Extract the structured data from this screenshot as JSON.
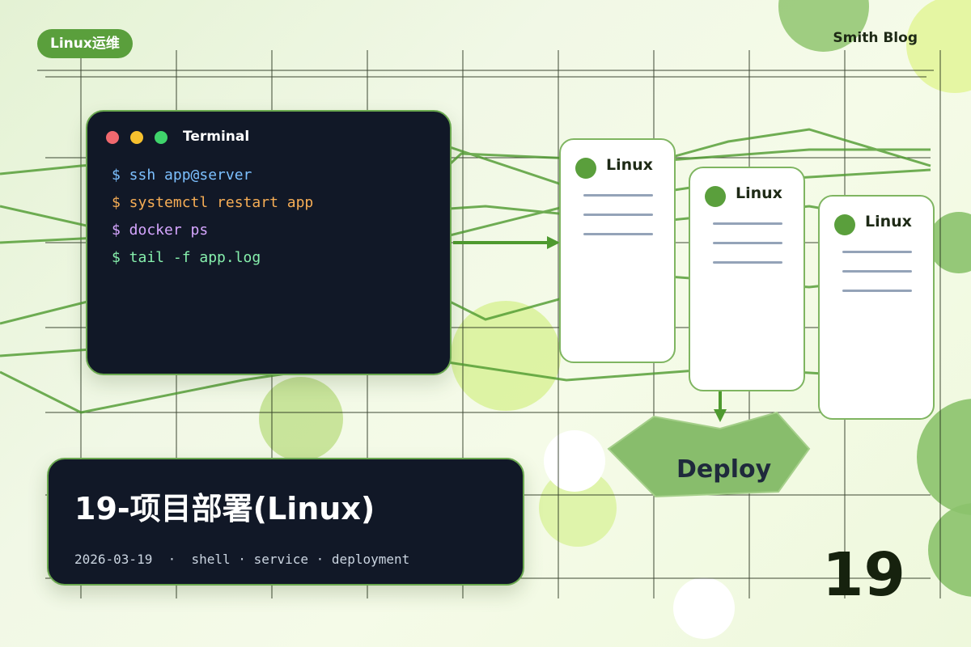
{
  "tag": "Linux运维",
  "brand": "Smith Blog",
  "terminal": {
    "title": "Terminal",
    "commands": [
      {
        "text": "$ ssh app@server",
        "color": "#7cc0ff"
      },
      {
        "text": "$ systemctl restart app",
        "color": "#f6ad55"
      },
      {
        "text": "$ docker ps",
        "color": "#d6a6ff"
      },
      {
        "text": "$ tail -f app.log",
        "color": "#86efac"
      }
    ]
  },
  "servers": [
    "Linux",
    "Linux",
    "Linux"
  ],
  "deploy": "Deploy",
  "post": {
    "title": "19-项目部署(Linux)",
    "date": "2026-03-19",
    "tags": [
      "shell",
      "service",
      "deployment"
    ],
    "number": "19"
  },
  "colors": {
    "accent": "#5a9f3c",
    "dark": "#111827",
    "line_green": "#4e9a2f"
  }
}
